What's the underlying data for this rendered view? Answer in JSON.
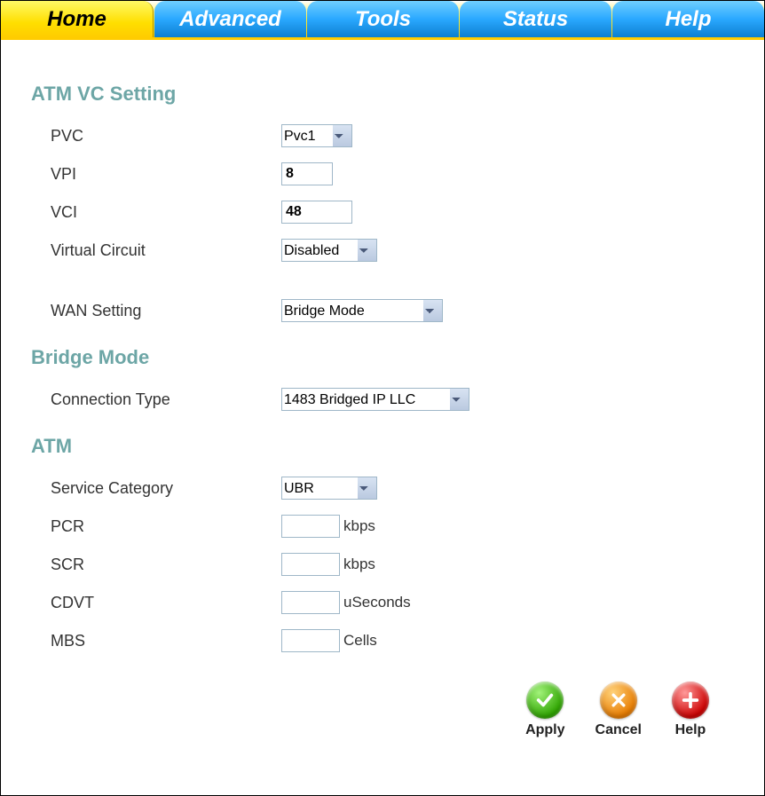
{
  "tabs": {
    "home": "Home",
    "advanced": "Advanced",
    "tools": "Tools",
    "status": "Status",
    "help": "Help"
  },
  "sections": {
    "atm_vc": "ATM VC Setting",
    "bridge": "Bridge Mode",
    "atm": "ATM"
  },
  "labels": {
    "pvc": "PVC",
    "vpi": "VPI",
    "vci": "VCI",
    "vc": "Virtual Circuit",
    "wan": "WAN Setting",
    "conn": "Connection Type",
    "svc": "Service Category",
    "pcr": "PCR",
    "scr": "SCR",
    "cdvt": "CDVT",
    "mbs": "MBS"
  },
  "values": {
    "pvc": "Pvc1",
    "vpi": "8",
    "vci": "48",
    "vc": "Disabled",
    "wan": "Bridge Mode",
    "conn": "1483 Bridged IP LLC",
    "svc": "UBR",
    "pcr": "",
    "scr": "",
    "cdvt": "",
    "mbs": ""
  },
  "units": {
    "pcr": "kbps",
    "scr": "kbps",
    "cdvt": "uSeconds",
    "mbs": "Cells"
  },
  "actions": {
    "apply": "Apply",
    "cancel": "Cancel",
    "help": "Help"
  }
}
